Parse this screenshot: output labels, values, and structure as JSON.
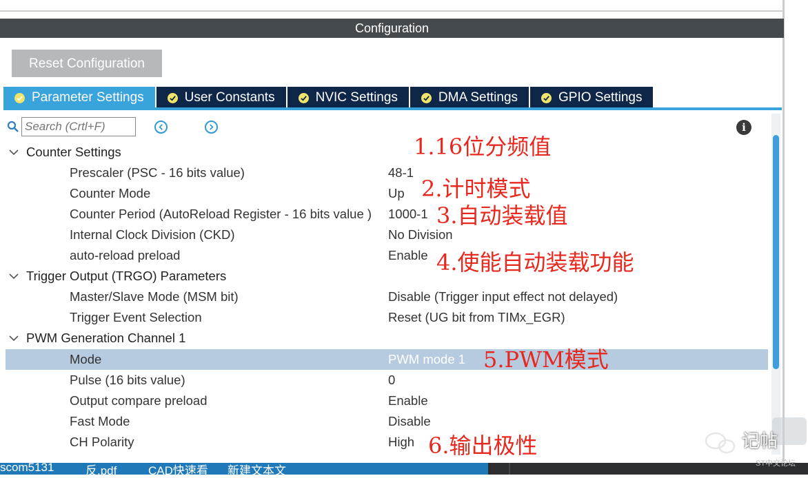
{
  "config_title": "Configuration",
  "reset_label": "Reset Configuration",
  "tabs": [
    {
      "label": "Parameter Settings",
      "active": true
    },
    {
      "label": "User Constants",
      "active": false
    },
    {
      "label": "NVIC Settings",
      "active": false
    },
    {
      "label": "DMA Settings",
      "active": false
    },
    {
      "label": "GPIO Settings",
      "active": false
    }
  ],
  "search": {
    "placeholder": "Search (Crtl+F)"
  },
  "groups": {
    "counter": "Counter Settings",
    "trigger": "Trigger Output (TRGO) Parameters",
    "pwm": "PWM Generation Channel 1"
  },
  "rows": {
    "prescaler": {
      "label": "Prescaler (PSC - 16 bits value)",
      "value": "48-1"
    },
    "counter_mode": {
      "label": "Counter Mode",
      "value": "Up"
    },
    "counter_period": {
      "label": "Counter Period (AutoReload Register - 16 bits value )",
      "value": "1000-1"
    },
    "ckd": {
      "label": "Internal Clock Division (CKD)",
      "value": "No Division"
    },
    "arpe": {
      "label": "auto-reload preload",
      "value": "Enable"
    },
    "msm": {
      "label": "Master/Slave Mode (MSM bit)",
      "value": "Disable (Trigger input effect not delayed)"
    },
    "trgo": {
      "label": "Trigger Event Selection",
      "value": "Reset (UG bit from TIMx_EGR)"
    },
    "mode": {
      "label": "Mode",
      "value": "PWM mode 1"
    },
    "pulse": {
      "label": "Pulse (16 bits value)",
      "value": "0"
    },
    "oc_preload": {
      "label": "Output compare preload",
      "value": "Enable"
    },
    "fast_mode": {
      "label": "Fast Mode",
      "value": "Disable"
    },
    "ch_polarity": {
      "label": "CH Polarity",
      "value": "High"
    }
  },
  "annotations": {
    "a1": "1.16位分频值",
    "a2": "2.计时模式",
    "a3": "3.自动装载值",
    "a4": "4.使能自动装载功能",
    "a5": "5.PWM模式",
    "a6": "6.输出极性"
  },
  "taskbar": [
    "scom5131",
    "反.pdf",
    "CAD快速看",
    "新建文本文"
  ],
  "watermark": {
    "text": "记帖",
    "sub": "ST中文论坛"
  },
  "colors": {
    "accent": "#39a4dc",
    "tab_bg": "#0e2749",
    "header_bg": "#454a4f",
    "annotation": "#e8281e",
    "selected_row": "#b6cbe0"
  }
}
